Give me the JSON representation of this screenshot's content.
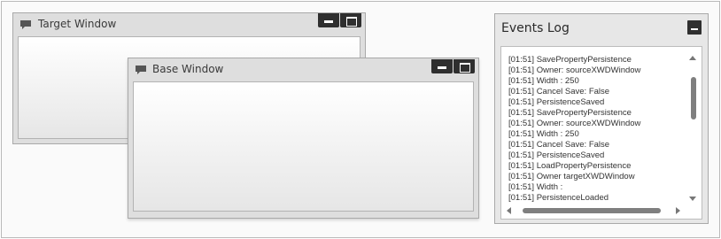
{
  "target_window": {
    "title": "Target Window",
    "icon": "speech-bubble-icon",
    "controls": [
      "minimize-icon",
      "maximize-icon"
    ]
  },
  "base_window": {
    "title": "Base Window",
    "icon": "speech-bubble-icon",
    "controls": [
      "minimize-icon",
      "maximize-icon"
    ]
  },
  "events_log": {
    "title": "Events Log",
    "lines": [
      "[01:51] SavePropertyPersistence",
      "[01:51] Owner: sourceXWDWindow",
      "[01:51] Width : 250",
      "[01:51] Cancel Save: False",
      "[01:51] PersistenceSaved",
      "[01:51] SavePropertyPersistence",
      "[01:51] Owner: sourceXWDWindow",
      "[01:51] Width : 250",
      "[01:51] Cancel Save: False",
      "[01:51] PersistenceSaved",
      "[01:51] LoadPropertyPersistence",
      "[01:51] Owner targetXWDWindow",
      "[01:51] Width :",
      "[01:51] PersistenceLoaded"
    ]
  },
  "colors": {
    "window_chrome": "#dedede",
    "control_button": "#2f2f2f",
    "log_text": "#333333"
  }
}
